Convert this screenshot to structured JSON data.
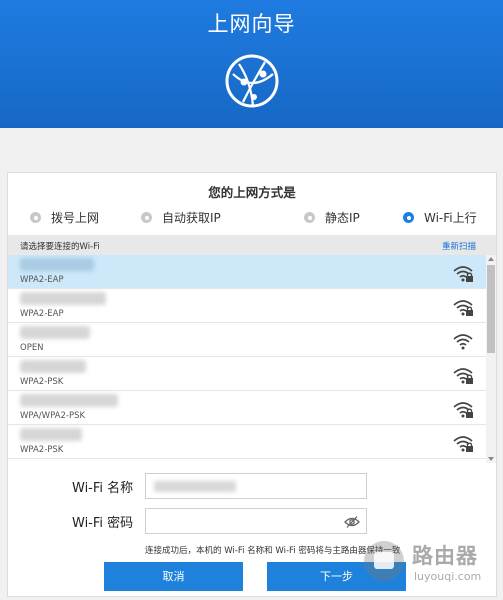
{
  "header": {
    "title": "上网向导",
    "icon": "globe-network-icon",
    "color": "#1a73d8"
  },
  "mode_section": {
    "heading": "您的上网方式是",
    "options": [
      {
        "label": "拨号上网",
        "selected": false
      },
      {
        "label": "自动获取IP",
        "selected": false
      },
      {
        "label": "静态IP",
        "selected": false
      },
      {
        "label": "Wi-Fi上行",
        "selected": true
      }
    ]
  },
  "wifi_list": {
    "hint": "请选择要连接的Wi-Fi",
    "rescan_label": "重新扫描",
    "networks": [
      {
        "security": "WPA2-EAP",
        "locked": true,
        "selected": true
      },
      {
        "security": "WPA2-EAP",
        "locked": true,
        "selected": false
      },
      {
        "security": "OPEN",
        "locked": false,
        "selected": false
      },
      {
        "security": "WPA2-PSK",
        "locked": true,
        "selected": false
      },
      {
        "security": "WPA/WPA2-PSK",
        "locked": true,
        "selected": false
      },
      {
        "security": "WPA2-PSK",
        "locked": true,
        "selected": false
      }
    ]
  },
  "form": {
    "name_label": "Wi-Fi 名称",
    "password_label": "Wi-Fi 密码",
    "note": "连接成功后，本机的 Wi-Fi 名称和 Wi-Fi 密码将与主路由器保持一致"
  },
  "buttons": {
    "cancel": "取消",
    "next": "下一步"
  },
  "watermark": {
    "cn": "路由器",
    "en": "luyouqi.com"
  },
  "colors": {
    "accent": "#1e82dc",
    "selected_row": "#cce8f9"
  }
}
